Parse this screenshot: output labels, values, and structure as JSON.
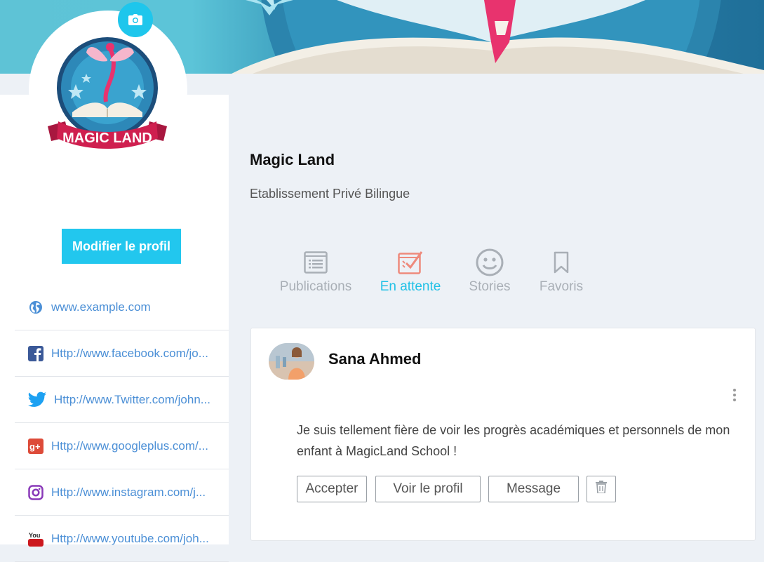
{
  "profile": {
    "name": "Magic Land",
    "subtitle": "Etablissement Privé Bilingue",
    "logo_text": "MAGIC LAND",
    "edit_button": "Modifier le profil"
  },
  "links": [
    {
      "icon": "globe-icon",
      "text": "www.example.com",
      "color": "#4b8fd6"
    },
    {
      "icon": "facebook-icon",
      "text": "Http://www.facebook.com/jo...",
      "color": "#3b5998"
    },
    {
      "icon": "twitter-icon",
      "text": "Http://www.Twitter.com/john...",
      "color": "#1da1f2"
    },
    {
      "icon": "googleplus-icon",
      "text": "Http://www.googleplus.com/...",
      "color": "#dd4b39"
    },
    {
      "icon": "instagram-icon",
      "text": "Http://www.instagram.com/j...",
      "color": "#8a3ab9"
    },
    {
      "icon": "youtube-icon",
      "text": "Http://www.youtube.com/joh...",
      "color": "#cc181e"
    }
  ],
  "tabs": [
    {
      "label": "Publications",
      "icon": "list-icon",
      "active": false
    },
    {
      "label": "En attente",
      "icon": "checklist-icon",
      "active": true
    },
    {
      "label": "Stories",
      "icon": "smiley-icon",
      "active": false
    },
    {
      "label": "Favoris",
      "icon": "bookmark-icon",
      "active": false
    }
  ],
  "post": {
    "user_name": "Sana Ahmed",
    "message": "Je suis tellement fière de voir les progrès académiques et personnels de mon enfant à MagicLand School !",
    "actions": {
      "accept": "Accepter",
      "view_profile": "Voir le profil",
      "message": "Message"
    }
  },
  "colors": {
    "accent": "#22c7ee",
    "active_tab": "#22c1e6",
    "inactive_tab": "#a9afb6",
    "link": "#4b8fd6"
  }
}
